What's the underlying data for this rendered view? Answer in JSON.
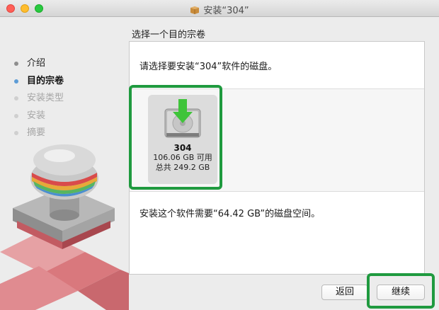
{
  "window": {
    "title": "安装“304”"
  },
  "page": {
    "subtitle": "选择一个目的宗卷"
  },
  "sidebar": {
    "steps": [
      {
        "label": "介绍",
        "state": "done"
      },
      {
        "label": "目的宗卷",
        "state": "current"
      },
      {
        "label": "安装类型",
        "state": "todo"
      },
      {
        "label": "安装",
        "state": "todo"
      },
      {
        "label": "摘要",
        "state": "todo"
      }
    ]
  },
  "panel": {
    "prompt": "请选择要安装“304”软件的磁盘。",
    "disk": {
      "name": "304",
      "available": "106.06 GB 可用",
      "total": "总共 249.2 GB",
      "icon": "hard-drive-download-icon"
    },
    "requirement": "安装这个软件需要“64.42 GB”的磁盘空间。"
  },
  "buttons": {
    "back": "返回",
    "continue": "继续"
  },
  "colors": {
    "current_step_dot": "#5d9cd6",
    "annotation_green": "#1f9a3f",
    "download_arrow": "#3fc43a"
  }
}
